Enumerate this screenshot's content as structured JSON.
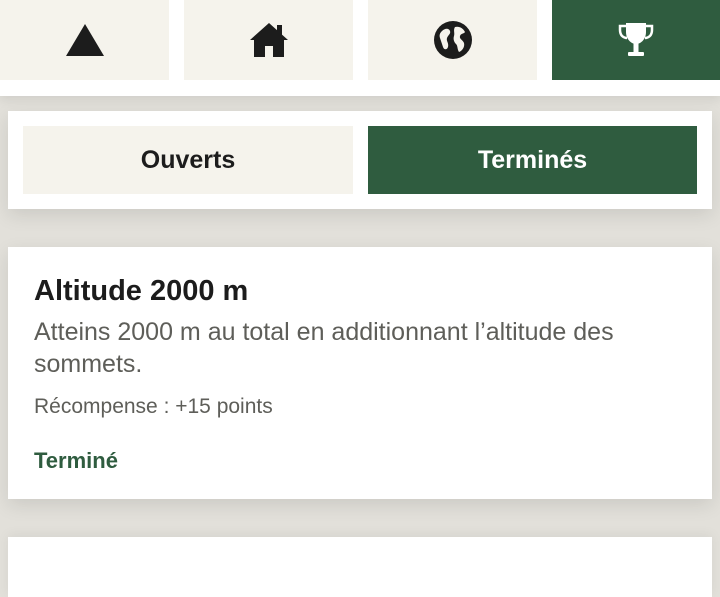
{
  "nav": {
    "tabs": [
      {
        "icon": "mountain-icon",
        "active": false
      },
      {
        "icon": "home-icon",
        "active": false
      },
      {
        "icon": "globe-icon",
        "active": false
      },
      {
        "icon": "trophy-icon",
        "active": true
      }
    ]
  },
  "filter": {
    "open_label": "Ouverts",
    "done_label": "Terminés",
    "selected": "done"
  },
  "achievements": [
    {
      "title": "Altitude 2000 m",
      "description": "Atteins 2000 m au total en additionnant l’altitude des sommets.",
      "reward": "Récompense : +15 points",
      "status": "Terminé"
    }
  ],
  "colors": {
    "accent": "#2f5c3f",
    "tab_bg": "#f5f3ec",
    "page_bg": "#e2e0da",
    "text_dark": "#1c1c1c",
    "text_muted": "#5e5e59"
  }
}
